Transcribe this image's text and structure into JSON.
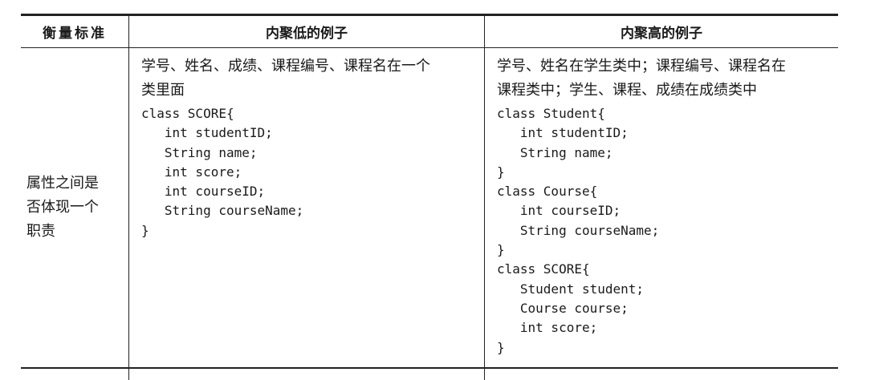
{
  "headers": [
    "衡量标准",
    "内聚低的例子",
    "内聚高的例子"
  ],
  "criterion_lines": [
    "属性之间是",
    "否体现一个",
    "职责"
  ],
  "low": {
    "description_lines": [
      "学号、姓名、成绩、课程编号、课程名在一个",
      "类里面"
    ],
    "code_lines": [
      "class SCORE{",
      "   int studentID;",
      "   String name;",
      "   int score;",
      "   int courseID;",
      "   String courseName;",
      "}"
    ]
  },
  "high": {
    "description_lines": [
      "学号、姓名在学生类中；课程编号、课程名在",
      "课程类中；学生、课程、成绩在成绩类中"
    ],
    "code_lines": [
      "class Student{",
      "   int studentID;",
      "   String name;",
      "}",
      "class Course{",
      "   int courseID;",
      "   String courseName;",
      "}",
      "class SCORE{",
      "   Student student;",
      "   Course course;",
      "   int score;",
      "}"
    ]
  }
}
